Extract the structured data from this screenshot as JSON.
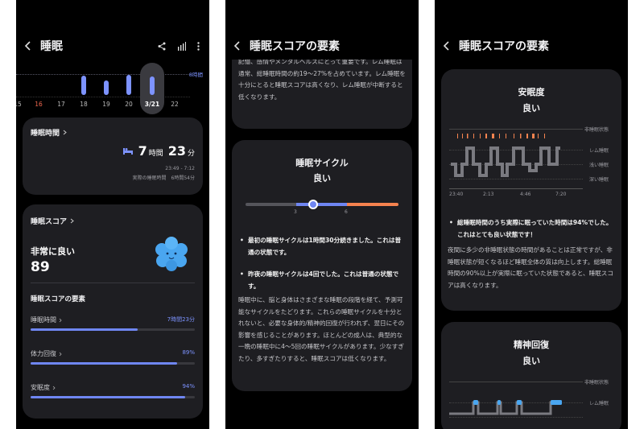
{
  "screen1": {
    "title": "睡眠",
    "chart_max_label": "8時間",
    "days": [
      "15",
      "16",
      "17",
      "18",
      "19",
      "20",
      "3/21",
      "22"
    ],
    "sleep_time": {
      "label": "睡眠時間",
      "hours": "7",
      "hours_unit": "時間",
      "minutes": "23",
      "minutes_unit": "分",
      "range": "23:49 - 7:12",
      "actual": "実際の睡眠時間　6時間54分"
    },
    "score": {
      "label": "睡眠スコア",
      "rating": "非常に良い",
      "value": "89",
      "factors_title": "睡眠スコアの要素",
      "factors": [
        {
          "label": "睡眠時間",
          "value": "7時間23分",
          "progress": 0.65
        },
        {
          "label": "体力回復",
          "value": "89%",
          "progress": 0.89
        },
        {
          "label": "安眠度",
          "value": "94%",
          "progress": 0.94
        }
      ]
    }
  },
  "screen2": {
    "title": "睡眠スコアの要素",
    "top_text": "記憶、感情やメンタルヘルスにとって重要です。レム睡眠は通常、総睡眠時間の約19〜27%を占めています。レム睡眠を十分にとると睡眠スコアは高くなり、レム睡眠が中断すると低くなります。",
    "cycle": {
      "title": "睡眠サイクル",
      "rating": "良い",
      "tick1": "3",
      "tick2": "6",
      "value": 4
    },
    "bullet1": "最初の睡眠サイクルは1時間30分続きました。これは普通の状態です。",
    "bullet2": "昨夜の睡眠サイクルは4回でした。これは普通の状態です。",
    "paragraph": "睡眠中に、脳と身体はさまざまな睡眠の段階を経て、予測可能なサイクルをたどります。これらの睡眠サイクルを十分とれないと、必要な身体的/精神的回復が行われず、翌日にその影響を感じることがあります。ほとんどの成人は、典型的な一晩の睡眠中に4〜5回の睡眠サイクルがあります。少なすぎたり、多すぎたりすると、睡眠スコアは低くなります。"
  },
  "screen3": {
    "title": "睡眠スコアの要素",
    "quality": {
      "title": "安眠度",
      "rating": "良い",
      "legend": [
        "非睡眠状態",
        "レム睡眠",
        "浅い睡眠",
        "深い睡眠"
      ],
      "times": [
        "23:40",
        "2:13",
        "4:46",
        "7:20"
      ]
    },
    "bullet": "総睡眠時間のうち実際に眠っていた時間は94%でした。これはとても良い状態です！",
    "paragraph": "夜間に多少の非睡眠状態の時間があることは正常ですが、非睡眠状態が短くなるほど睡眠全体の質は向上します。総睡眠時間の90%以上が実際に眠っていた状態であると、睡眠スコアは高くなります。",
    "recovery": {
      "title": "精神回復",
      "rating": "良い",
      "legend": [
        "非睡眠状態",
        "レム睡眠"
      ]
    }
  },
  "colors": {
    "accent": "#6f86f2",
    "orange": "#f5834f",
    "card": "#1e1e22"
  }
}
